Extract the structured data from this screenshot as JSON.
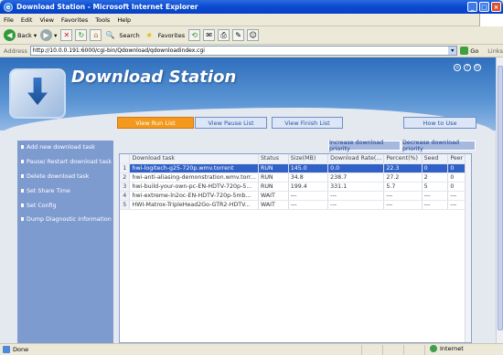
{
  "window": {
    "title": "Download Station - Microsoft Internet Explorer"
  },
  "menu": [
    "File",
    "Edit",
    "View",
    "Favorites",
    "Tools",
    "Help"
  ],
  "toolbar": {
    "back": "Back",
    "search": "Search",
    "favorites": "Favorites"
  },
  "address": {
    "label": "Address",
    "url": "http://10.0.0.191:6000/cgi-bin/Qdownload/qdownloadindex.cgi",
    "go": "Go",
    "links": "Links"
  },
  "page": {
    "title": "Download Station",
    "tabs": [
      "View Run List",
      "View Pause List",
      "View Finish List",
      "How to Use"
    ],
    "sidebar": [
      "Add new download task",
      "Pause/ Restart download task",
      "Delete download task",
      "Set Share Time",
      "Set Config",
      "Dump Diagnostic Information"
    ],
    "priority": {
      "increase": "Increase download priority",
      "decrease": "Decrease download priority"
    },
    "table": {
      "headers": [
        "",
        "Download task",
        "Status",
        "Size(MB)",
        "Download Rate(...",
        "Percent(%)",
        "Seed",
        "Peer"
      ],
      "rows": [
        [
          "1",
          "hwi-logitech-g25-720p.wmv.torrent",
          "RUN",
          "145.0",
          "0.0",
          "22.3",
          "0",
          "0"
        ],
        [
          "2",
          "hwi-anti-aliasing-demonstration.wmv.torr...",
          "RUN",
          "34.8",
          "238.7",
          "27.2",
          "2",
          "0"
        ],
        [
          "3",
          "hwi-build-your-own-pc-EN-HDTV-720p-5...",
          "RUN",
          "199.4",
          "331.1",
          "5.7",
          "5",
          "0"
        ],
        [
          "4",
          "hwi-extreme-ln2oc-EN-HDTV-720p-5mb...",
          "WAIT",
          "---",
          "---",
          "---",
          "---",
          "---"
        ],
        [
          "5",
          "HWI-Matrox-TripleHead2Go-GTR2-HDTV...",
          "WAIT",
          "---",
          "---",
          "---",
          "---",
          "---"
        ]
      ]
    }
  },
  "status": {
    "left": "Done",
    "zone": "Internet"
  }
}
